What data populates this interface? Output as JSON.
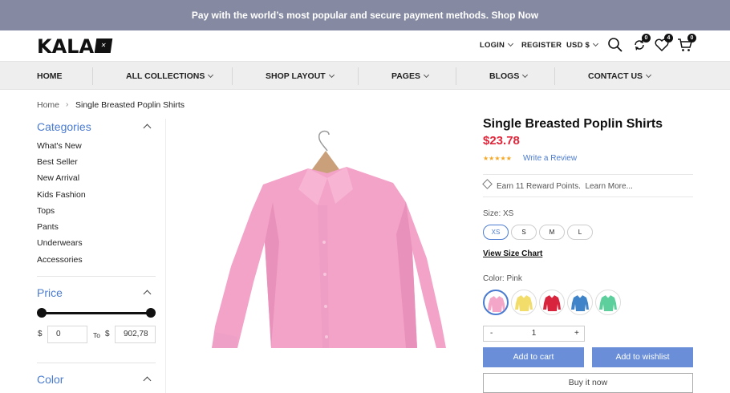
{
  "promo": {
    "text": "Pay with the world’s most popular and secure payment methods. Shop Now"
  },
  "header": {
    "logo": "KALA",
    "login": "LOGIN",
    "register": "REGISTER",
    "currency": "USD $",
    "compare_count": "0",
    "wishlist_count": "4",
    "cart_count": "0"
  },
  "nav": {
    "items": [
      "HOME",
      "ALL COLLECTIONS",
      "SHOP LAYOUT",
      "PAGES",
      "BLOGS",
      "CONTACT US"
    ]
  },
  "breadcrumb": {
    "home": "Home",
    "separator": "›",
    "current": "Single Breasted Poplin Shirts"
  },
  "sidebar": {
    "categories_title": "Categories",
    "categories": [
      "What's New",
      "Best Seller",
      "New Arrival",
      "Kids Fashion",
      "Tops",
      "Pants",
      "Underwears",
      "Accessories"
    ],
    "price_title": "Price",
    "price_min_fraction": 0.0,
    "price_max_fraction": 1.0,
    "currency_symbol": "$",
    "to_label": "To",
    "price_from": "0",
    "price_to": "902,78",
    "color_title": "Color"
  },
  "product": {
    "title": "Single Breasted Poplin Shirts",
    "price": "$23.78",
    "stars": "★★★★★",
    "rating": 5,
    "review_link": "Write a Review",
    "reward": "Earn 11 Reward Points.",
    "learn_more": "Learn More...",
    "size_label": "Size: XS",
    "sizes": [
      "XS",
      "S",
      "M",
      "L"
    ],
    "selected_size": "XS",
    "size_chart": "View Size Chart",
    "color_label": "Color: Pink",
    "colors": [
      {
        "name": "Pink",
        "hex": "#f3a6c8"
      },
      {
        "name": "Yellow",
        "hex": "#f2dd6b"
      },
      {
        "name": "Red",
        "hex": "#d8243d"
      },
      {
        "name": "Blue",
        "hex": "#3f83c9"
      },
      {
        "name": "Green",
        "hex": "#5ccf9d"
      }
    ],
    "qty_minus": "-",
    "qty": "1",
    "qty_plus": "+",
    "add_to_cart": "Add to cart",
    "add_to_wishlist": "Add to wishlist",
    "buy_now": "Buy it now"
  },
  "colors": {
    "accent": "#4a7bd0",
    "price": "#e0263a",
    "promo_bg": "#858aa2",
    "button": "#6a8fd8"
  }
}
